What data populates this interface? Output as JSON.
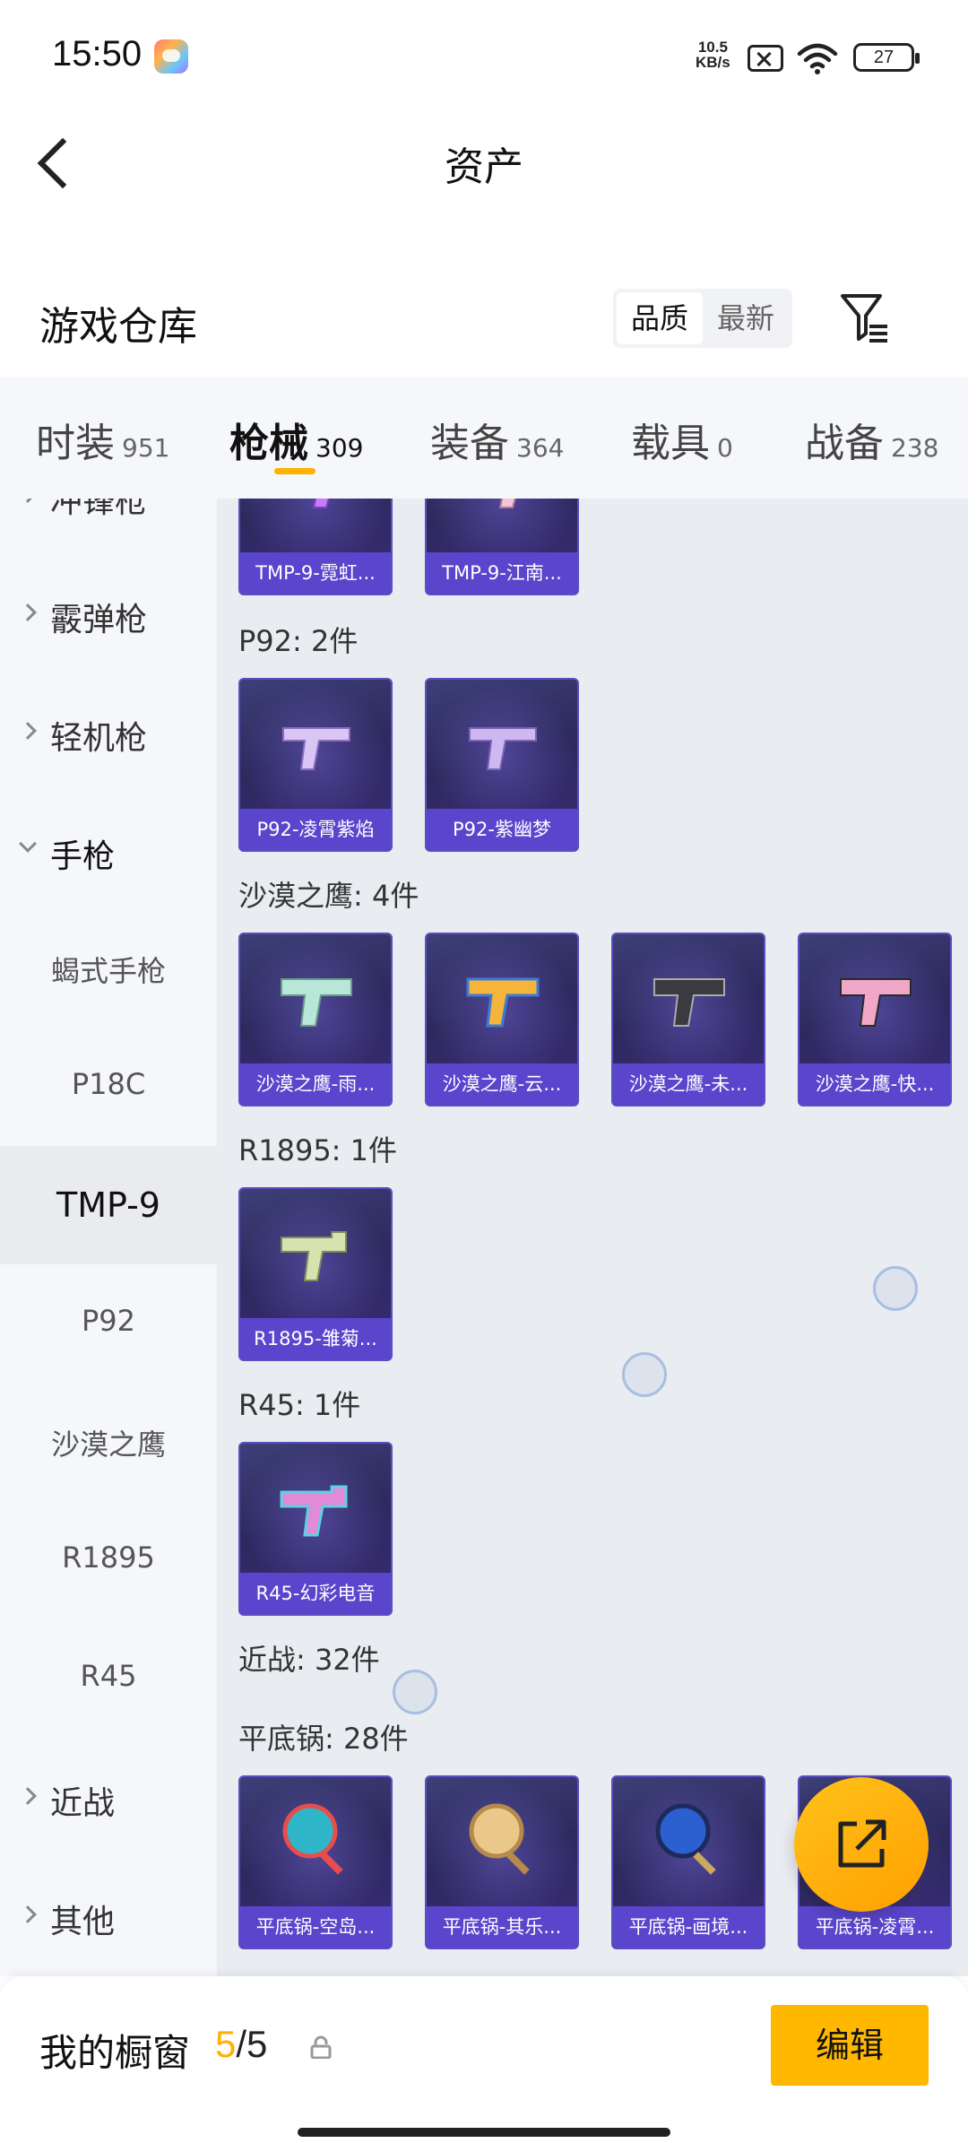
{
  "status": {
    "time": "15:50",
    "speed_value": "10.5",
    "speed_unit": "KB/s",
    "battery": "27"
  },
  "header": {
    "title": "资产"
  },
  "warehouse": {
    "title": "游戏仓库",
    "sort_options": [
      "品质",
      "最新"
    ],
    "sort_active": "品质"
  },
  "tabs": [
    {
      "label": "时装",
      "count": "951"
    },
    {
      "label": "枪械",
      "count": "309"
    },
    {
      "label": "装备",
      "count": "364"
    },
    {
      "label": "载具",
      "count": "0"
    },
    {
      "label": "战备",
      "count": "238"
    }
  ],
  "active_tab": "枪械",
  "sidebar": {
    "partial_top": "冲锋枪",
    "items": [
      {
        "label": "霰弹枪",
        "type": "category"
      },
      {
        "label": "轻机枪",
        "type": "category"
      },
      {
        "label": "手枪",
        "type": "category-open"
      },
      {
        "label": "蝎式手枪",
        "type": "sub"
      },
      {
        "label": "P18C",
        "type": "sub"
      },
      {
        "label": "TMP-9",
        "type": "sub-active"
      },
      {
        "label": "P92",
        "type": "sub"
      },
      {
        "label": "沙漠之鹰",
        "type": "sub"
      },
      {
        "label": "R1895",
        "type": "sub"
      },
      {
        "label": "R45",
        "type": "sub"
      },
      {
        "label": "近战",
        "type": "category"
      },
      {
        "label": "其他",
        "type": "category"
      }
    ]
  },
  "content": {
    "top_items": [
      "TMP-9-霓虹...",
      "TMP-9-江南..."
    ],
    "groups": [
      {
        "heading": "P92: 2件",
        "items": [
          "P92-凌霄紫焰",
          "P92-紫幽梦"
        ]
      },
      {
        "heading": "沙漠之鹰: 4件",
        "items": [
          "沙漠之鹰-雨...",
          "沙漠之鹰-云...",
          "沙漠之鹰-未...",
          "沙漠之鹰-快..."
        ]
      },
      {
        "heading": "R1895: 1件",
        "items": [
          "R1895-雏菊..."
        ]
      },
      {
        "heading": "R45: 1件",
        "items": [
          "R45-幻彩电音"
        ]
      },
      {
        "heading": "近战: 32件",
        "items": []
      },
      {
        "heading": "平底锅: 28件",
        "items": [
          "平底锅-空岛...",
          "平底锅-其乐...",
          "平底锅-画境...",
          "平底锅-凌霄..."
        ]
      }
    ]
  },
  "bottom": {
    "showcase_label": "我的橱窗",
    "used": "5",
    "total": "/5",
    "edit_label": "编辑"
  },
  "colors": {
    "accent": "#ffb000",
    "card_caption": "#5a45cc",
    "card_bg": "#2d2a5e"
  },
  "icons": {
    "back": "chevron-left-icon",
    "filter": "filter-icon",
    "share": "share-external-icon",
    "lock": "lock-icon"
  }
}
